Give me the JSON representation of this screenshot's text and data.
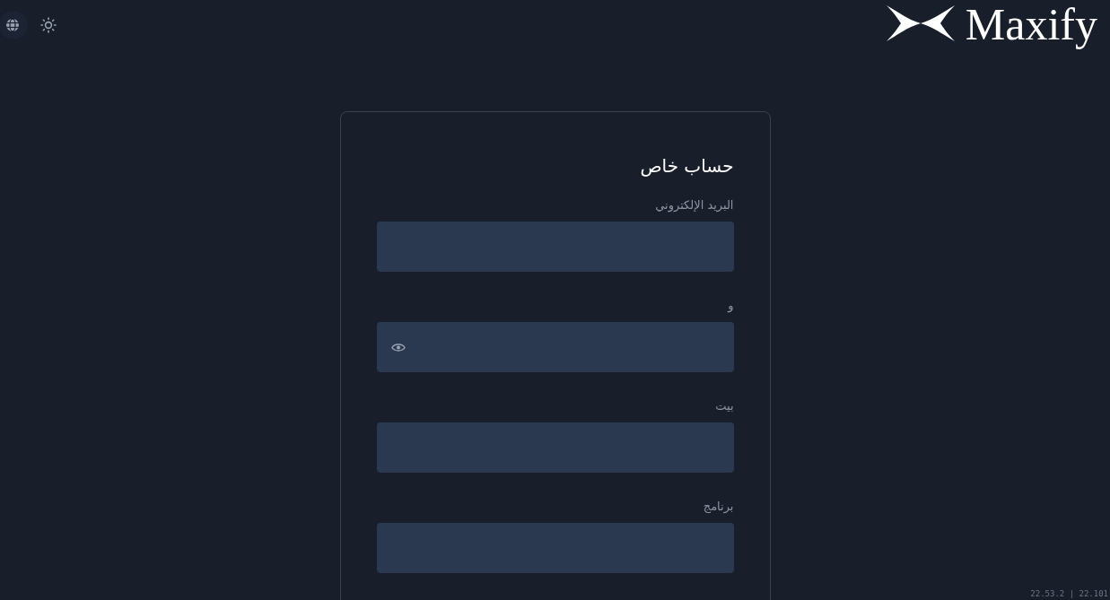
{
  "logo": {
    "text": "Maxify"
  },
  "form": {
    "title": "حساب خاص",
    "fields": [
      {
        "label": "البريد الإلكتروني",
        "kind": "text"
      },
      {
        "label": "و",
        "kind": "password"
      },
      {
        "label": "بيت",
        "kind": "text"
      },
      {
        "label": "برنامج",
        "kind": "text"
      }
    ]
  },
  "version": "22.53.2 | 22.101"
}
